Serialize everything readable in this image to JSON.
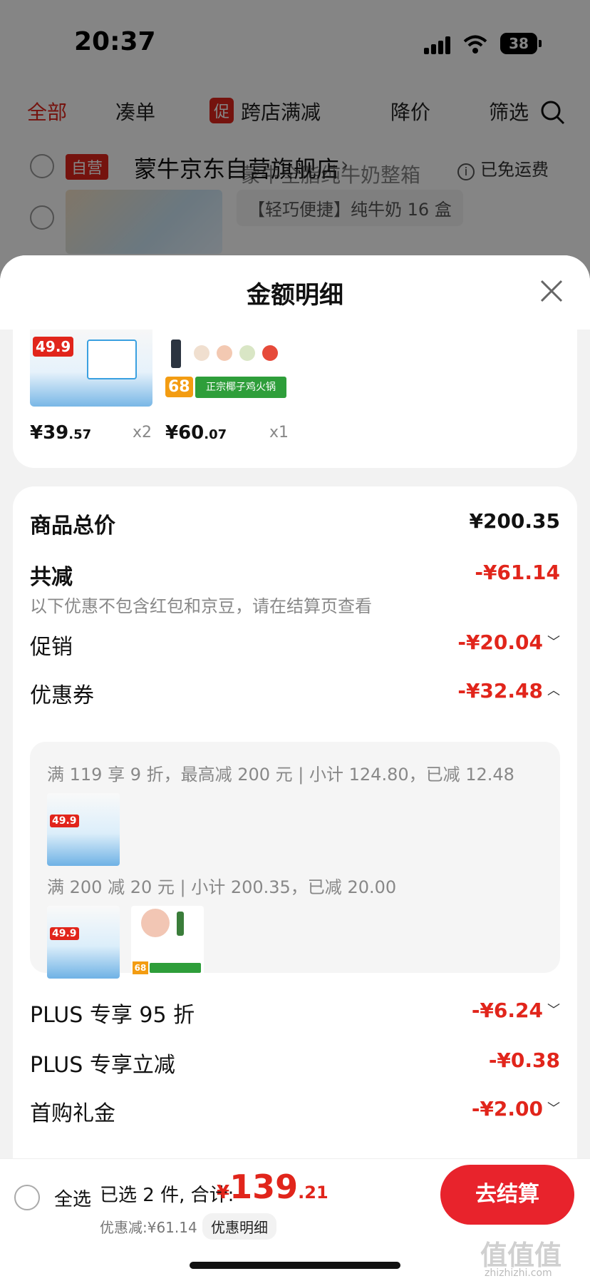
{
  "status_bar": {
    "time": "20:37",
    "battery": "38"
  },
  "tabs": [
    {
      "label": "全部",
      "active": true
    },
    {
      "label": "凑单",
      "active": false
    },
    {
      "label": "跨店满减",
      "badge": "促",
      "active": false
    },
    {
      "label": "降价",
      "active": false
    },
    {
      "label": "筛选",
      "active": false
    }
  ],
  "store": {
    "badge": "自营",
    "name": "蒙牛京东自营旗舰店",
    "shipping": "已免运费",
    "product_name": "蒙牛全脂纯牛奶整箱",
    "sku": "【轻巧便捷】纯牛奶 16 盒"
  },
  "sheet": {
    "title": "金额明细",
    "products": [
      {
        "price_int": "¥39",
        "price_dec": ".57",
        "qty": "x2",
        "tag": "49.9"
      },
      {
        "price_int": "¥60",
        "price_dec": ".07",
        "qty": "x1",
        "tag": "68",
        "banner": "正宗椰子鸡火锅"
      }
    ],
    "total": {
      "label": "商品总价",
      "value": "¥200.35"
    },
    "reduction": {
      "label": "共减",
      "value": "-¥61.14",
      "note": "以下优惠不包含红包和京豆，请在结算页查看"
    },
    "promo": {
      "label": "促销",
      "value": "-¥20.04"
    },
    "coupon": {
      "label": "优惠券",
      "value": "-¥32.48",
      "lines": [
        "满 119 享 9 折，最高减 200 元 | 小计 124.80，已减 12.48",
        "满 200 减 20 元 | 小计 200.35，已减 20.00"
      ]
    },
    "plus_discount": {
      "label": "PLUS 专享 95 折",
      "value": "-¥6.24"
    },
    "plus_instant": {
      "label": "PLUS 专享立减",
      "value": "-¥0.38"
    },
    "first_gift": {
      "label": "首购礼金",
      "value": "-¥2.00"
    }
  },
  "bottom": {
    "select_all": "全选",
    "selected": "已选 2 件, 合计:",
    "currency": "¥",
    "total_int": "139",
    "total_dec": ".21",
    "discount": "优惠减:¥61.14",
    "detail_btn": "优惠明细",
    "checkout": "去结算",
    "watermark": "值值值",
    "watermark_sub": "zhizhizhi.com"
  },
  "colors": {
    "accent": "#e1251b",
    "checkout": "#e8232c"
  }
}
